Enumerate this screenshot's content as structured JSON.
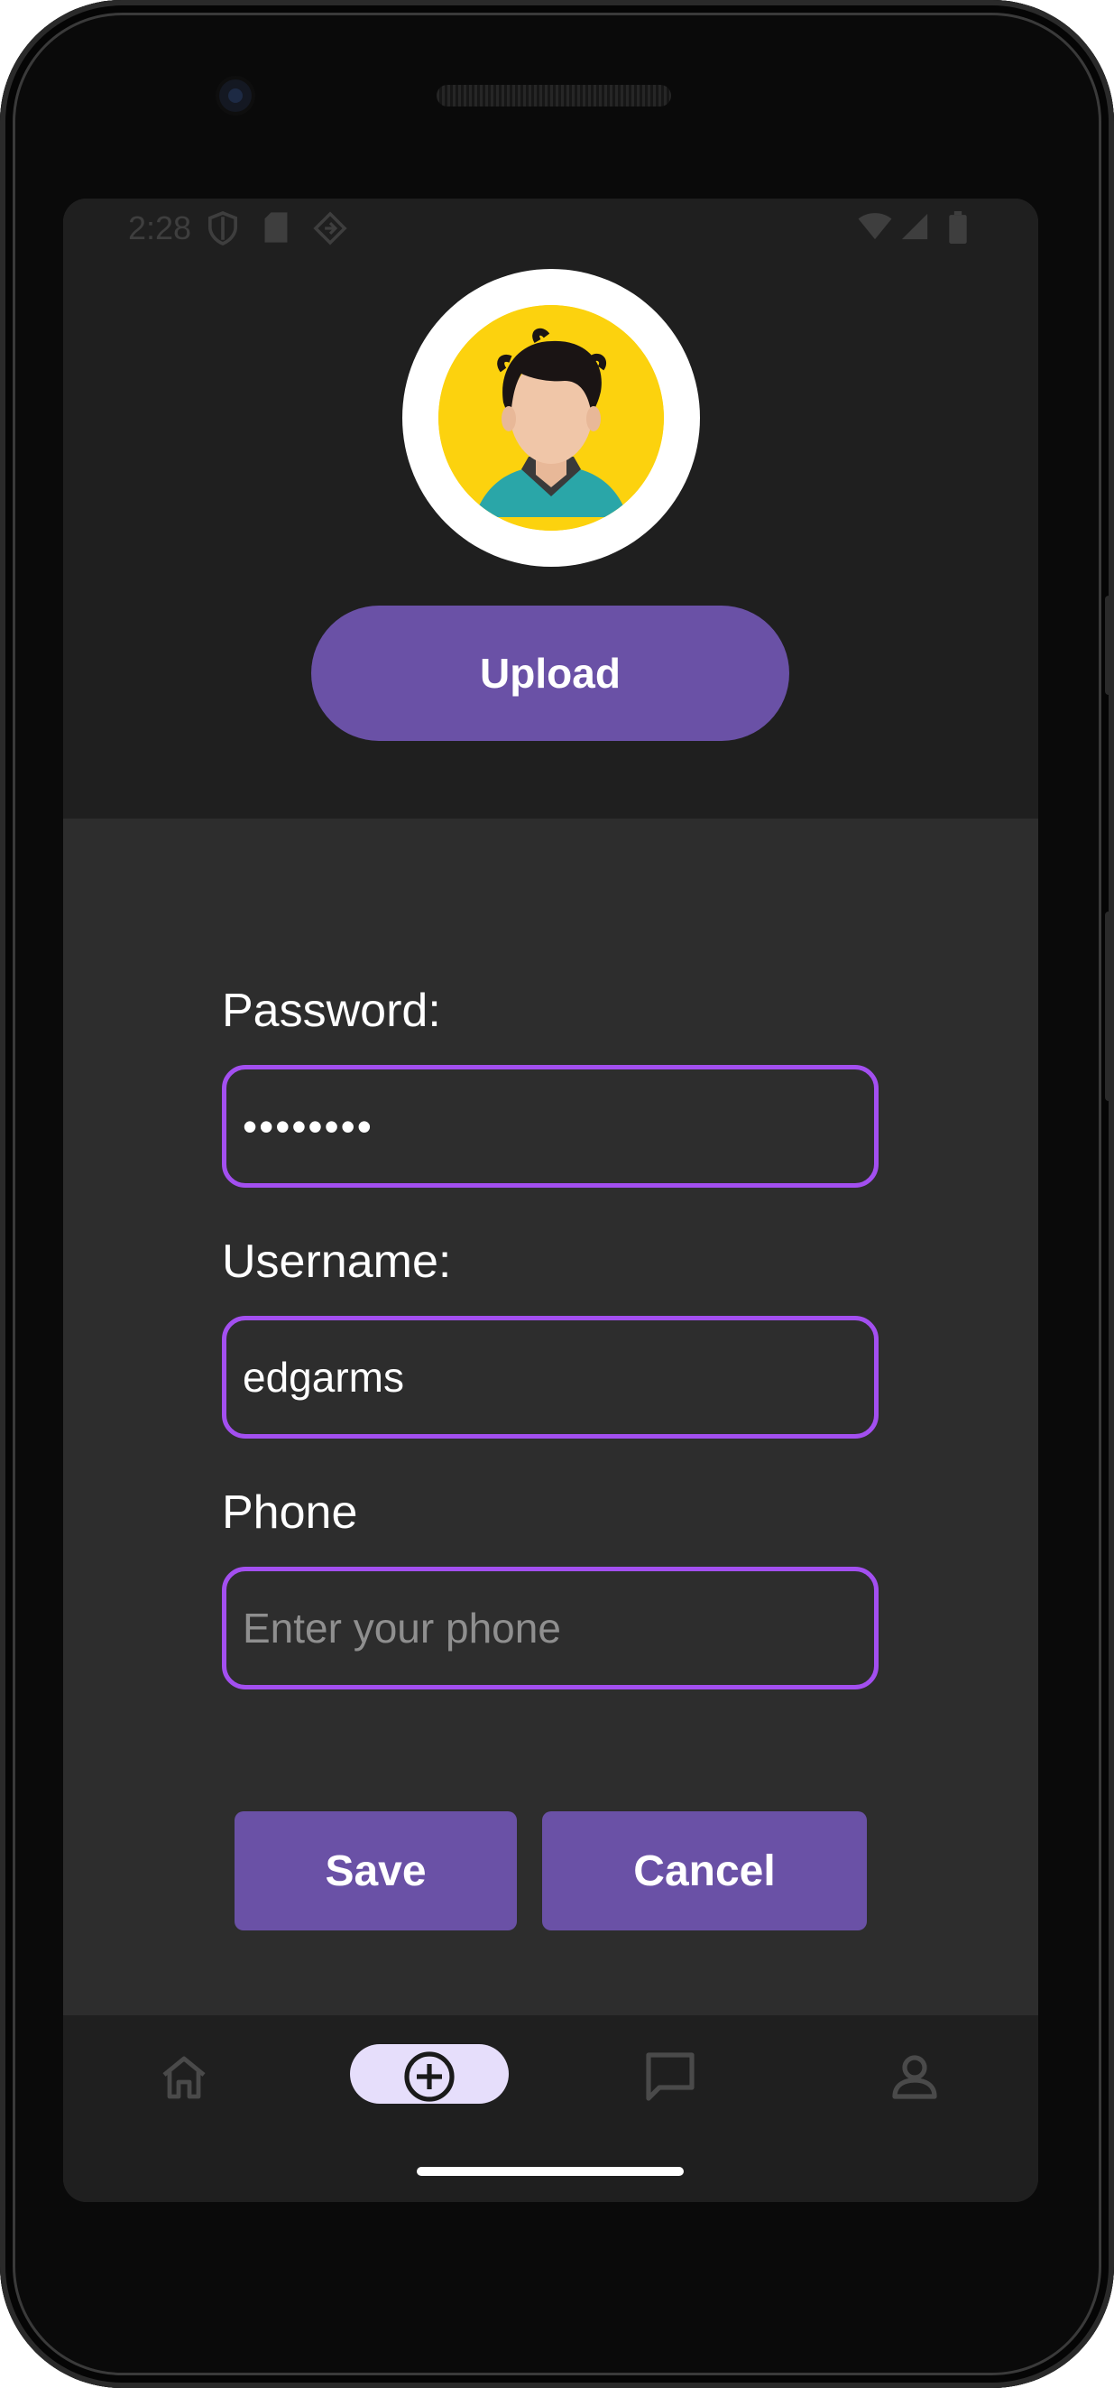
{
  "status_bar": {
    "time": "2:28",
    "icons": [
      "shield-icon",
      "sd-card-icon",
      "cast-icon",
      "wifi-icon",
      "signal-icon",
      "battery-icon"
    ]
  },
  "profile": {
    "avatar_icon": "person-avatar-icon",
    "upload_label": "Upload"
  },
  "form": {
    "password": {
      "label": "Password:",
      "value": "••••••••"
    },
    "username": {
      "label": "Username:",
      "value": "edgarms"
    },
    "phone": {
      "label": "Phone",
      "value": "",
      "placeholder": "Enter your phone"
    }
  },
  "actions": {
    "save_label": "Save",
    "cancel_label": "Cancel"
  },
  "bottom_nav": {
    "items": [
      {
        "icon": "home-icon",
        "active": false
      },
      {
        "icon": "add-circle-icon",
        "active": true
      },
      {
        "icon": "chat-icon",
        "active": false
      },
      {
        "icon": "profile-icon",
        "active": false
      }
    ]
  },
  "colors": {
    "accent": "#6a51a6",
    "input_border": "#a34ff0",
    "screen_bg": "#2d2d2d",
    "header_bg": "#1f1f1f",
    "nav_active_pill": "#e6defb"
  }
}
